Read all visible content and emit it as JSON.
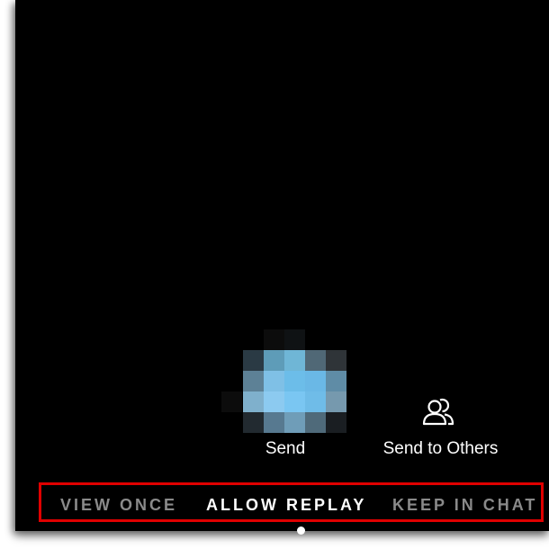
{
  "actions": {
    "send_label": "Send",
    "send_to_others_label": "Send to Others",
    "send_to_others_icon": "people-icon"
  },
  "modes": [
    {
      "label": "VIEW ONCE",
      "selected": false
    },
    {
      "label": "ALLOW REPLAY",
      "selected": true
    },
    {
      "label": "KEEP IN CHAT",
      "selected": false
    }
  ],
  "colors": {
    "background": "#000000",
    "highlight_border": "#e00000",
    "active_mode_text": "#ffffff",
    "inactive_mode_text": "#8a8a8a",
    "send_button_blue": "#6ab8e6"
  }
}
